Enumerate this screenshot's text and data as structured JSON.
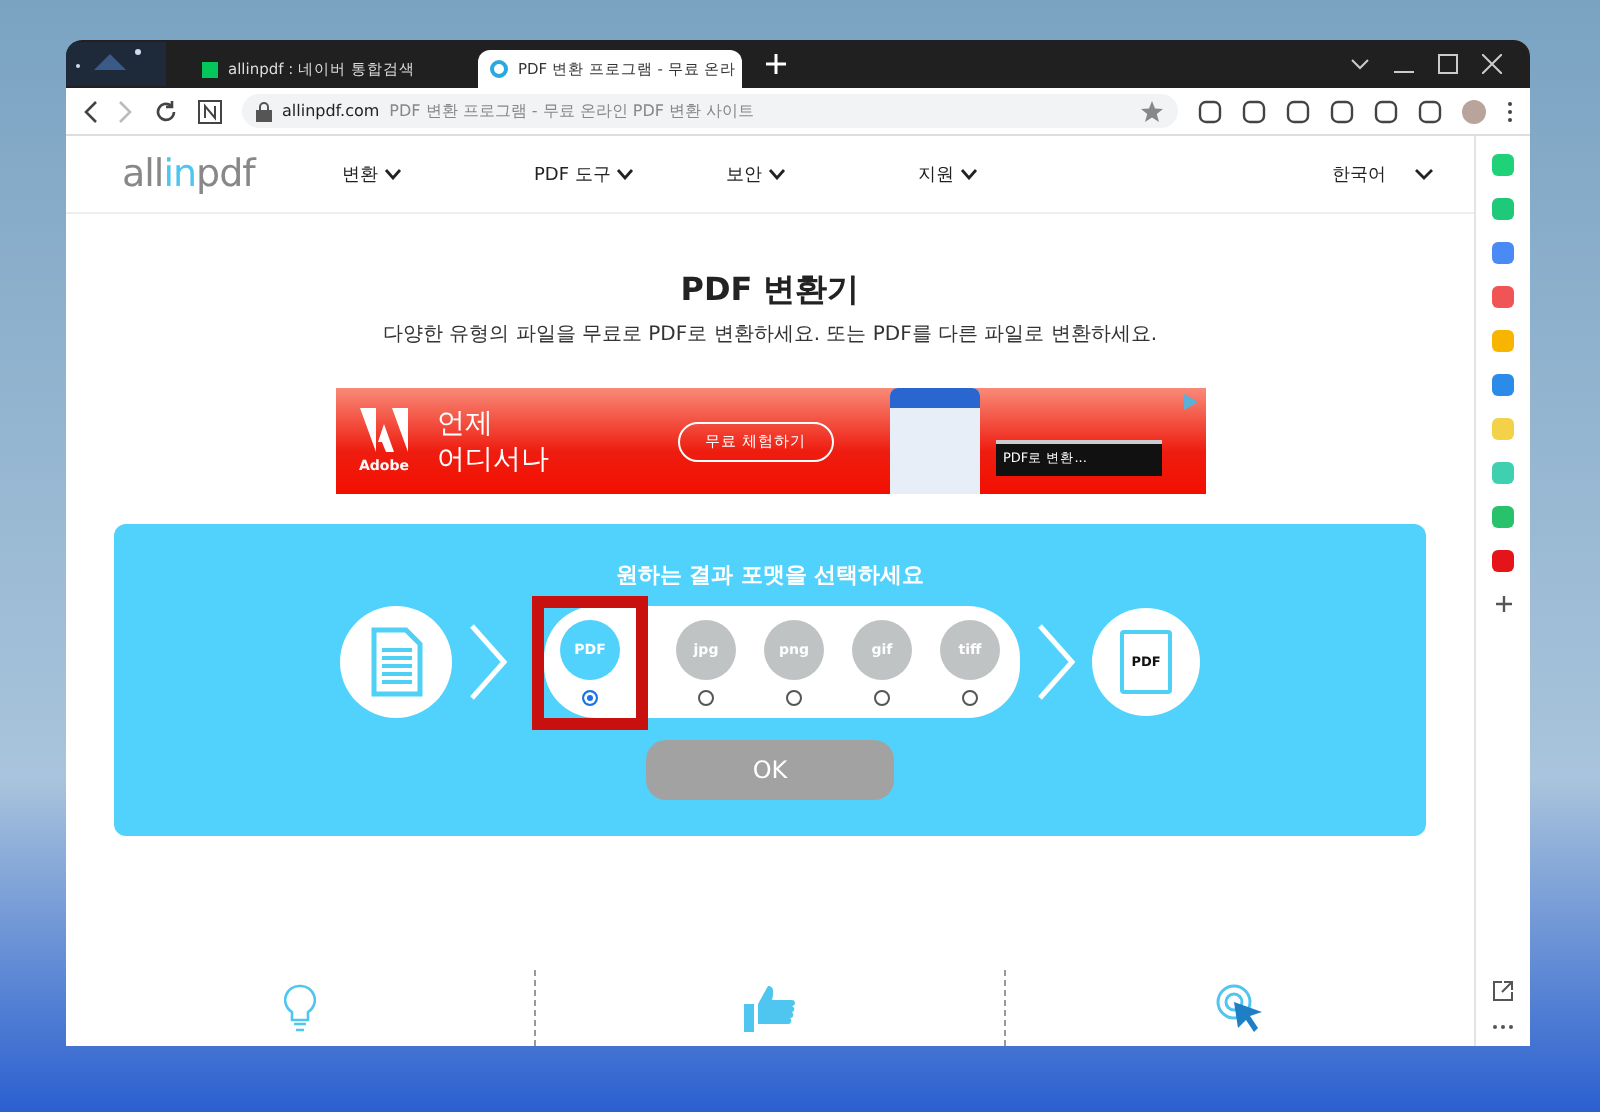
{
  "browser": {
    "tabs": [
      {
        "title": "allinpdf : 네이버 통합검색",
        "selected": false,
        "kind": "naver"
      },
      {
        "title": "PDF 변환 프로그램 - 무료 온라",
        "selected": true,
        "kind": "allinpdf"
      }
    ],
    "address": {
      "domain": "allinpdf.com",
      "page_title": "PDF 변환 프로그램 - 무료 온라인 PDF 변환 사이트"
    }
  },
  "site": {
    "logo": {
      "before": "all",
      "accent": "in",
      "after": "pdf"
    },
    "nav": [
      {
        "label": "변환"
      },
      {
        "label": "PDF 도구"
      },
      {
        "label": "보안"
      },
      {
        "label": "지원"
      }
    ],
    "language": "한국어"
  },
  "heading": "PDF 변환기",
  "subtitle": "다양한 유형의 파일을 무료로 PDF로 변환하세요. 또는 PDF를 다른 파일로 변환하세요.",
  "ad": {
    "brand": "Adobe",
    "headline": [
      "언제",
      "어디서나"
    ],
    "cta": "무료 체험하기",
    "popup": "PDF로 변환..."
  },
  "converter": {
    "prompt": "원하는 결과 포맷을 선택하세요",
    "formats": [
      {
        "label": "PDF",
        "selected": true,
        "highlighted": true
      },
      {
        "label": "jpg",
        "selected": false,
        "highlighted": false
      },
      {
        "label": "png",
        "selected": false,
        "highlighted": false
      },
      {
        "label": "gif",
        "selected": false,
        "highlighted": false
      },
      {
        "label": "tiff",
        "selected": false,
        "highlighted": false
      }
    ],
    "output_label": "PDF",
    "ok": "OK"
  }
}
